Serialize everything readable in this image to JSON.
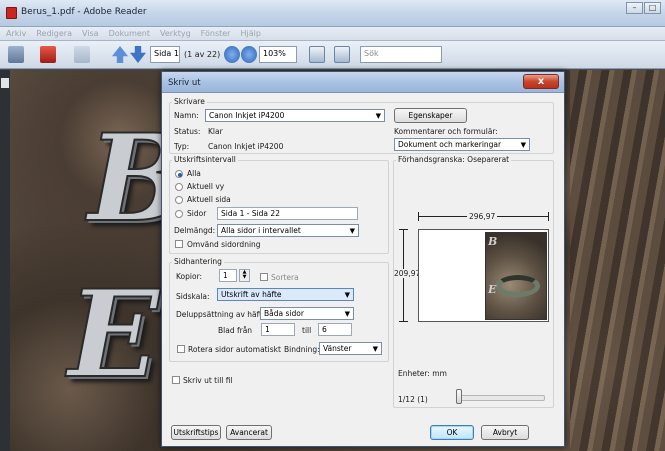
{
  "app": {
    "title": "Berus_1.pdf - Adobe Reader",
    "window_buttons": [
      "–",
      "□"
    ]
  },
  "menu": [
    "Arkiv",
    "Redigera",
    "Visa",
    "Dokument",
    "Verktyg",
    "Fönster",
    "Hjälp"
  ],
  "toolbar": {
    "page_value": "Sida 1",
    "page_count": "(1 av 22)",
    "zoom": "103%",
    "search_placeholder": "Sök"
  },
  "document": {
    "letters": [
      "B",
      "E"
    ]
  },
  "dialog": {
    "title": "Skriv ut",
    "close_label": "x",
    "printer": {
      "legend": "Skrivare",
      "name_label": "Namn:",
      "name_value": "Canon Inkjet iP4200",
      "status_label": "Status:",
      "status_value": "Klar",
      "type_label": "Typ:",
      "type_value": "Canon Inkjet iP4200",
      "properties_button": "Egenskaper",
      "comments_label": "Kommentarer och formulär:",
      "comments_value": "Dokument och markeringar"
    },
    "range": {
      "legend": "Utskriftsintervall",
      "options": [
        "Alla",
        "Aktuell vy",
        "Aktuell sida",
        "Sidor"
      ],
      "selected": "Alla",
      "pages_value": "Sida 1 - Sida 22",
      "subset_label": "Delmängd:",
      "subset_value": "Alla sidor i intervallet",
      "reverse_label": "Omvänd sidordning"
    },
    "handling": {
      "legend": "Sidhantering",
      "copies_label": "Kopior:",
      "copies_value": "1",
      "collate_label": "Sortera",
      "scaling_label": "Sidskala:",
      "scaling_value": "Utskrift av häfte",
      "booklet_label": "Deluppsättning av häfte:",
      "booklet_value": "Båda sidor",
      "sheets_from_label": "Blad från",
      "sheets_from_value": "1",
      "sheets_to_label": "till",
      "sheets_to_value": "6",
      "autorotate_label": "Rotera sidor automatiskt",
      "binding_label": "Bindning:",
      "binding_value": "Vänster"
    },
    "print_to_file_label": "Skriv ut till fil",
    "preview": {
      "legend": "Förhandsgranska: Oseparerat",
      "width": "296,97",
      "height": "209,97",
      "units_label": "Enheter: mm",
      "page_indicator": "1/12 (1)"
    },
    "buttons": {
      "tips": "Utskriftstips",
      "advanced": "Avancerat",
      "ok": "OK",
      "cancel": "Avbryt"
    }
  }
}
